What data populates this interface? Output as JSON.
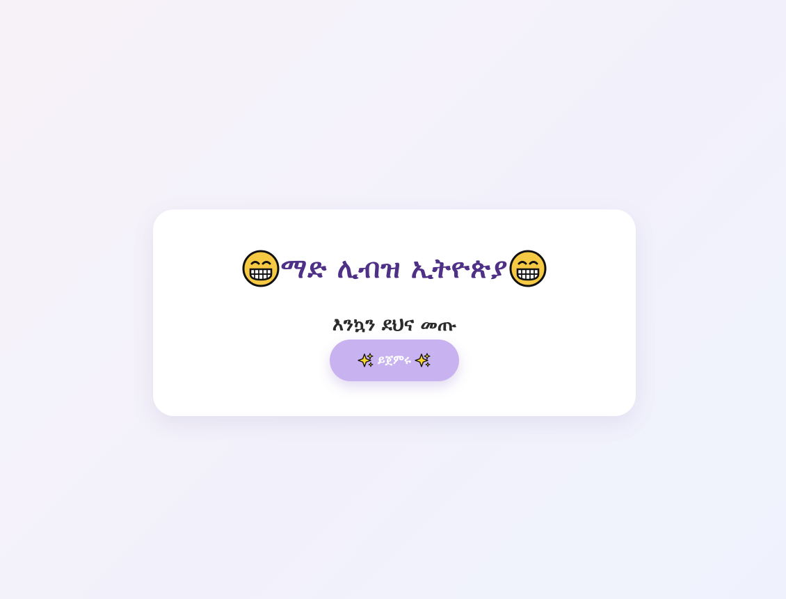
{
  "header": {
    "title": "ማድ ሊብዝ ኢትዮጵያ",
    "left_icon": "grinning-face-icon",
    "right_icon": "grinning-face-icon"
  },
  "subtitle": "እንኳን ደህና መጡ",
  "start_button": {
    "label": "ይጀምሩ",
    "left_icon": "sparkles-icon",
    "right_icon": "sparkles-icon"
  },
  "colors": {
    "title": "#4e3186",
    "subtitle": "#2b2b2b",
    "button_background": "#c8b2ef",
    "card_background": "#ffffff"
  }
}
